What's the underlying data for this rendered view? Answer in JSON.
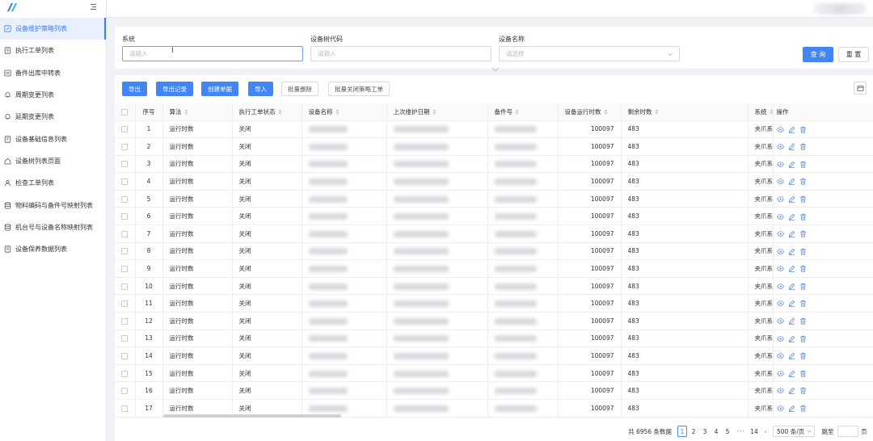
{
  "sidebar": {
    "items": [
      {
        "label": "设备维护策略列表",
        "icon": "edit-icon",
        "active": true
      },
      {
        "label": "执行工单列表",
        "icon": "document-icon"
      },
      {
        "label": "备件出库中转表",
        "icon": "list-icon"
      },
      {
        "label": "周期变更列表",
        "icon": "bell-icon"
      },
      {
        "label": "延期变更列表",
        "icon": "bell-icon"
      },
      {
        "label": "设备基础信息列表",
        "icon": "document-icon"
      },
      {
        "label": "设备树列表页面",
        "icon": "home-icon"
      },
      {
        "label": "检查工单列表",
        "icon": "users-icon"
      },
      {
        "label": "物料编码与备件号映射列表",
        "icon": "database-icon"
      },
      {
        "label": "机台号与设备名称映射列表",
        "icon": "database-icon"
      },
      {
        "label": "设备保养数据列表",
        "icon": "document-icon"
      }
    ]
  },
  "search": {
    "system_label": "系统",
    "system_placeholder": "请输入",
    "tree_code_label": "设备树代码",
    "tree_code_placeholder": "请输入",
    "device_name_label": "设备名称",
    "device_name_placeholder": "请选择",
    "query_label": "查 询",
    "reset_label": "重 置"
  },
  "toolbar": {
    "export": "导出",
    "export_log": "导出记录",
    "create_ticket": "创建单据",
    "import": "导入",
    "batch_delete": "批量删除",
    "batch_close": "批量关闭策略工单"
  },
  "table": {
    "headers": {
      "index": "序号",
      "algorithm": "算法",
      "status": "执行工单状态",
      "device_name": "设备名称",
      "last_date": "上次维护日期",
      "part_no": "备件号",
      "run_hours": "设备运行时数",
      "remaining": "剩余时数",
      "system": "系统",
      "actions": "操作"
    },
    "rows": [
      {
        "index": "1",
        "algorithm": "运行时数",
        "status": "关闭",
        "run_hours": "100097",
        "remaining": "483",
        "system": "夹爪系"
      },
      {
        "index": "2",
        "algorithm": "运行时数",
        "status": "关闭",
        "run_hours": "100097",
        "remaining": "483",
        "system": "夹爪系"
      },
      {
        "index": "3",
        "algorithm": "运行时数",
        "status": "关闭",
        "run_hours": "100097",
        "remaining": "483",
        "system": "夹爪系"
      },
      {
        "index": "4",
        "algorithm": "运行时数",
        "status": "关闭",
        "run_hours": "100097",
        "remaining": "483",
        "system": "夹爪系"
      },
      {
        "index": "5",
        "algorithm": "运行时数",
        "status": "关闭",
        "run_hours": "100097",
        "remaining": "483",
        "system": "夹爪系"
      },
      {
        "index": "6",
        "algorithm": "运行时数",
        "status": "关闭",
        "run_hours": "100097",
        "remaining": "483",
        "system": "夹爪系"
      },
      {
        "index": "7",
        "algorithm": "运行时数",
        "status": "关闭",
        "run_hours": "100097",
        "remaining": "483",
        "system": "夹爪系"
      },
      {
        "index": "8",
        "algorithm": "运行时数",
        "status": "关闭",
        "run_hours": "100097",
        "remaining": "483",
        "system": "夹爪系"
      },
      {
        "index": "9",
        "algorithm": "运行时数",
        "status": "关闭",
        "run_hours": "100097",
        "remaining": "483",
        "system": "夹爪系"
      },
      {
        "index": "10",
        "algorithm": "运行时数",
        "status": "关闭",
        "run_hours": "100097",
        "remaining": "483",
        "system": "夹爪系"
      },
      {
        "index": "11",
        "algorithm": "运行时数",
        "status": "关闭",
        "run_hours": "100097",
        "remaining": "483",
        "system": "夹爪系"
      },
      {
        "index": "12",
        "algorithm": "运行时数",
        "status": "关闭",
        "run_hours": "100097",
        "remaining": "483",
        "system": "夹爪系"
      },
      {
        "index": "13",
        "algorithm": "运行时数",
        "status": "关闭",
        "run_hours": "100097",
        "remaining": "483",
        "system": "夹爪系"
      },
      {
        "index": "14",
        "algorithm": "运行时数",
        "status": "关闭",
        "run_hours": "100097",
        "remaining": "483",
        "system": "夹爪系"
      },
      {
        "index": "15",
        "algorithm": "运行时数",
        "status": "关闭",
        "run_hours": "100097",
        "remaining": "483",
        "system": "夹爪系"
      },
      {
        "index": "16",
        "algorithm": "运行时数",
        "status": "关闭",
        "run_hours": "100097",
        "remaining": "483",
        "system": "夹爪系"
      },
      {
        "index": "17",
        "algorithm": "运行时数",
        "status": "关闭",
        "run_hours": "100097",
        "remaining": "483",
        "system": "夹爪系"
      }
    ]
  },
  "pagination": {
    "total": "共 6956 条数据",
    "pages": [
      "1",
      "2",
      "3",
      "4",
      "5"
    ],
    "ellipsis": "•••",
    "last_page": "14",
    "page_size": "500 条/页",
    "jump_label": "跳至",
    "page_suffix": "页"
  },
  "colors": {
    "primary": "#4285f4",
    "active_bg": "#e8f0fe",
    "action_icon": "#6b8fd6"
  }
}
